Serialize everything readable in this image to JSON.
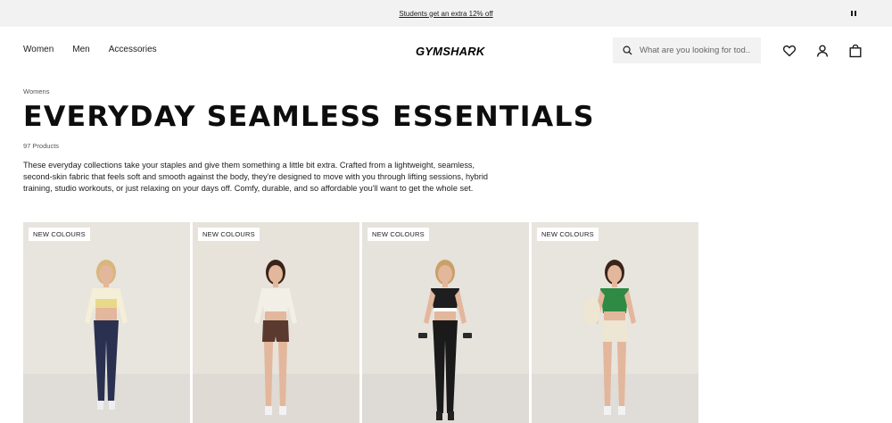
{
  "promo": {
    "text": "Students get an extra 12% off"
  },
  "header": {
    "nav": [
      "Women",
      "Men",
      "Accessories"
    ],
    "logo": "GYMSHARK",
    "search_placeholder": "What are you looking for tod..."
  },
  "page": {
    "breadcrumb": "Womens",
    "title": "EVERYDAY SEAMLESS ESSENTIALS",
    "product_count": "97 Products",
    "description": "These everyday collections take your staples and give them something a little bit extra. Crafted from a lightweight, seamless, second-skin fabric that feels soft and smooth against the body, they're designed to move with you through lifting sessions, hybrid training, studio workouts, or just relaxing on your days off. Comfy, durable, and so affordable you'll want to get the whole set."
  },
  "products": [
    {
      "badge": "NEW COLOURS",
      "top_color": "#f4efd6",
      "bra_color": "#e8d98a",
      "bottom_color": "#2a3150",
      "bg": "#e8e4de"
    },
    {
      "badge": "NEW COLOURS",
      "top_color": "#f2efe6",
      "bra_color": "#f2efe6",
      "bottom_color": "#5a3a2e",
      "bg": "#e7e2da"
    },
    {
      "badge": "NEW COLOURS",
      "top_color": "#1e1e1e",
      "bra_color": "#1e1e1e",
      "bottom_color": "#1a1a1a",
      "bg": "#e6e2dc"
    },
    {
      "badge": "NEW COLOURS",
      "top_color": "#2f8a43",
      "bra_color": "#2f8a43",
      "bottom_color": "#ece6d2",
      "bg": "#e8e4de"
    }
  ],
  "icons": [
    "pause-icon",
    "search-icon",
    "heart-icon",
    "user-icon",
    "bag-icon"
  ]
}
